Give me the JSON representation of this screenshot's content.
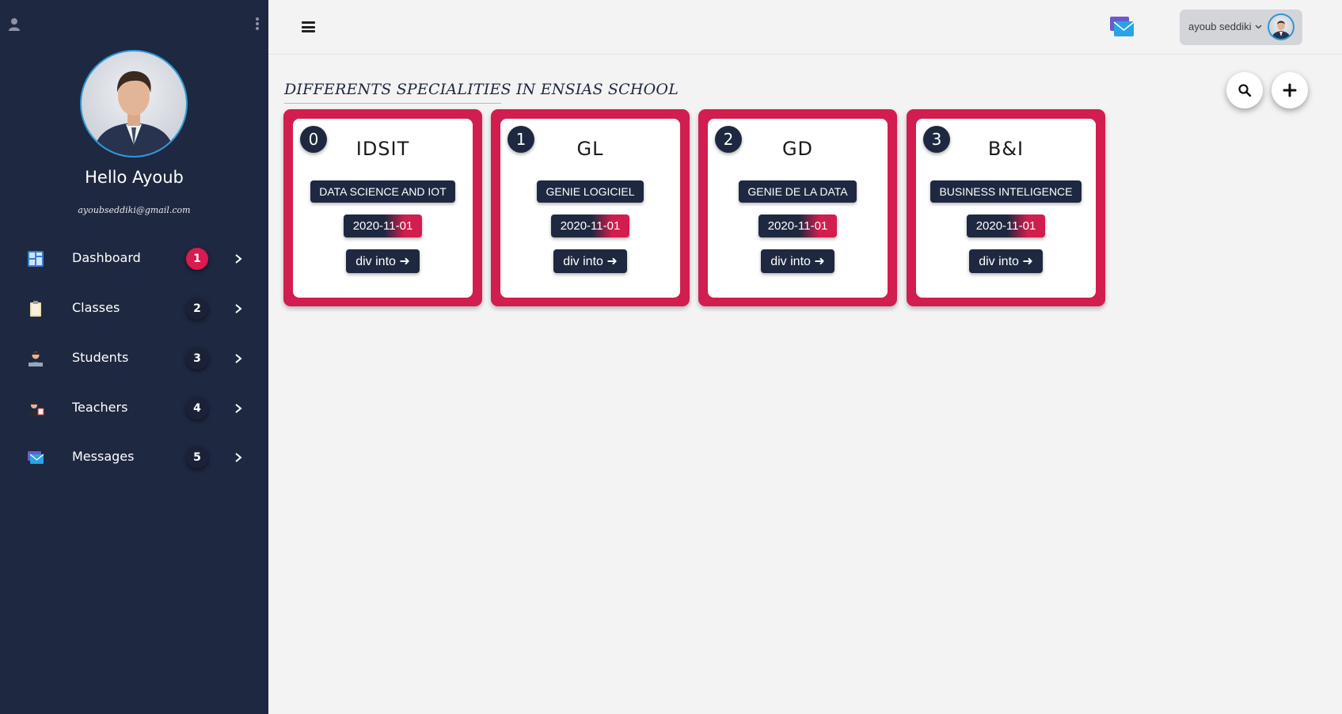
{
  "sidebar": {
    "greeting": "Hello Ayoub",
    "email": "ayoubseddiki@gmail.com",
    "items": [
      {
        "label": "Dashboard",
        "badge": "1",
        "icon": "dashboard-icon",
        "active": true
      },
      {
        "label": "Classes",
        "badge": "2",
        "icon": "clipboard-icon",
        "active": false
      },
      {
        "label": "Students",
        "badge": "3",
        "icon": "student-icon",
        "active": false
      },
      {
        "label": "Teachers",
        "badge": "4",
        "icon": "teacher-icon",
        "active": false
      },
      {
        "label": "Messages",
        "badge": "5",
        "icon": "mail-icon",
        "active": false
      }
    ]
  },
  "topbar": {
    "user_name": "ayoub seddiki",
    "menu_icon": "hamburger-icon",
    "mail_icon": "mail-icon"
  },
  "main": {
    "title": "DIFFERENTS SPECIALITIES IN ENSIAS SCHOOL",
    "search_icon": "search-icon",
    "add_icon": "plus-icon",
    "cards": [
      {
        "number": "0",
        "abbr": "IDSIT",
        "full_name": "DATA SCIENCE AND IOT",
        "date": "2020-11-01",
        "action": "div into"
      },
      {
        "number": "1",
        "abbr": "GL",
        "full_name": "GENIE LOGICIEL",
        "date": "2020-11-01",
        "action": "div into"
      },
      {
        "number": "2",
        "abbr": "GD",
        "full_name": "GENIE DE LA DATA",
        "date": "2020-11-01",
        "action": "div into"
      },
      {
        "number": "3",
        "abbr": "B&I",
        "full_name": "BUSINESS INTELIGENCE",
        "date": "2020-11-01",
        "action": "div into"
      }
    ]
  },
  "colors": {
    "sidebar_bg": "#1e2840",
    "accent": "#d21d4f",
    "avatar_ring": "#2e97d6",
    "page_bg": "#f3f3f3"
  }
}
